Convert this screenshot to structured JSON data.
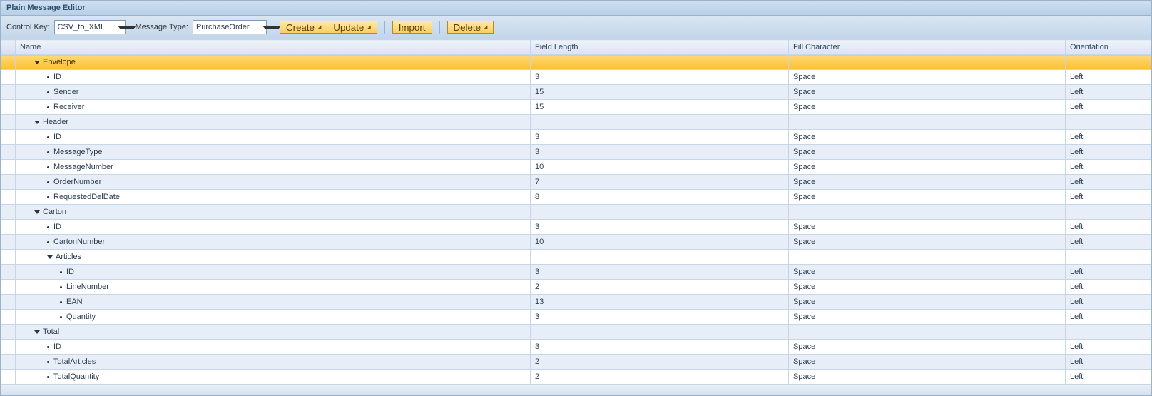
{
  "header": {
    "title": "Plain Message Editor"
  },
  "toolbar": {
    "controlKeyLabel": "Control Key:",
    "controlKeyValue": "CSV_to_XML",
    "messageTypeLabel": "Message Type:",
    "messageTypeValue": "PurchaseOrder",
    "createLabel": "Create",
    "updateLabel": "Update",
    "importLabel": "Import",
    "deleteLabel": "Delete"
  },
  "columns": {
    "name": "Name",
    "fieldLength": "Field Length",
    "fillCharacter": "Fill Character",
    "orientation": "Orientation"
  },
  "rows": [
    {
      "name": "Envelope",
      "len": "",
      "fill": "",
      "ori": "",
      "kind": "group",
      "indent": 1,
      "selected": true
    },
    {
      "name": "ID",
      "len": "3",
      "fill": "Space",
      "ori": "Left",
      "kind": "leaf",
      "indent": 2
    },
    {
      "name": "Sender",
      "len": "15",
      "fill": "Space",
      "ori": "Left",
      "kind": "leaf",
      "indent": 2
    },
    {
      "name": "Receiver",
      "len": "15",
      "fill": "Space",
      "ori": "Left",
      "kind": "leaf",
      "indent": 2
    },
    {
      "name": "Header",
      "len": "",
      "fill": "",
      "ori": "",
      "kind": "group",
      "indent": 1
    },
    {
      "name": "ID",
      "len": "3",
      "fill": "Space",
      "ori": "Left",
      "kind": "leaf",
      "indent": 2
    },
    {
      "name": "MessageType",
      "len": "3",
      "fill": "Space",
      "ori": "Left",
      "kind": "leaf",
      "indent": 2
    },
    {
      "name": "MessageNumber",
      "len": "10",
      "fill": "Space",
      "ori": "Left",
      "kind": "leaf",
      "indent": 2
    },
    {
      "name": "OrderNumber",
      "len": "7",
      "fill": "Space",
      "ori": "Left",
      "kind": "leaf",
      "indent": 2
    },
    {
      "name": "RequestedDelDate",
      "len": "8",
      "fill": "Space",
      "ori": "Left",
      "kind": "leaf",
      "indent": 2
    },
    {
      "name": "Carton",
      "len": "",
      "fill": "",
      "ori": "",
      "kind": "group",
      "indent": 1
    },
    {
      "name": "ID",
      "len": "3",
      "fill": "Space",
      "ori": "Left",
      "kind": "leaf",
      "indent": 2
    },
    {
      "name": "CartonNumber",
      "len": "10",
      "fill": "Space",
      "ori": "Left",
      "kind": "leaf",
      "indent": 2
    },
    {
      "name": "Articles",
      "len": "",
      "fill": "",
      "ori": "",
      "kind": "group",
      "indent": 2
    },
    {
      "name": "ID",
      "len": "3",
      "fill": "Space",
      "ori": "Left",
      "kind": "leaf",
      "indent": 3
    },
    {
      "name": "LineNumber",
      "len": "2",
      "fill": "Space",
      "ori": "Left",
      "kind": "leaf",
      "indent": 3
    },
    {
      "name": "EAN",
      "len": "13",
      "fill": "Space",
      "ori": "Left",
      "kind": "leaf",
      "indent": 3
    },
    {
      "name": "Quantity",
      "len": "3",
      "fill": "Space",
      "ori": "Left",
      "kind": "leaf",
      "indent": 3
    },
    {
      "name": "Total",
      "len": "",
      "fill": "",
      "ori": "",
      "kind": "group",
      "indent": 1
    },
    {
      "name": "ID",
      "len": "3",
      "fill": "Space",
      "ori": "Left",
      "kind": "leaf",
      "indent": 2
    },
    {
      "name": "TotalArticles",
      "len": "2",
      "fill": "Space",
      "ori": "Left",
      "kind": "leaf",
      "indent": 2
    },
    {
      "name": "TotalQuantity",
      "len": "2",
      "fill": "Space",
      "ori": "Left",
      "kind": "leaf",
      "indent": 2
    }
  ]
}
